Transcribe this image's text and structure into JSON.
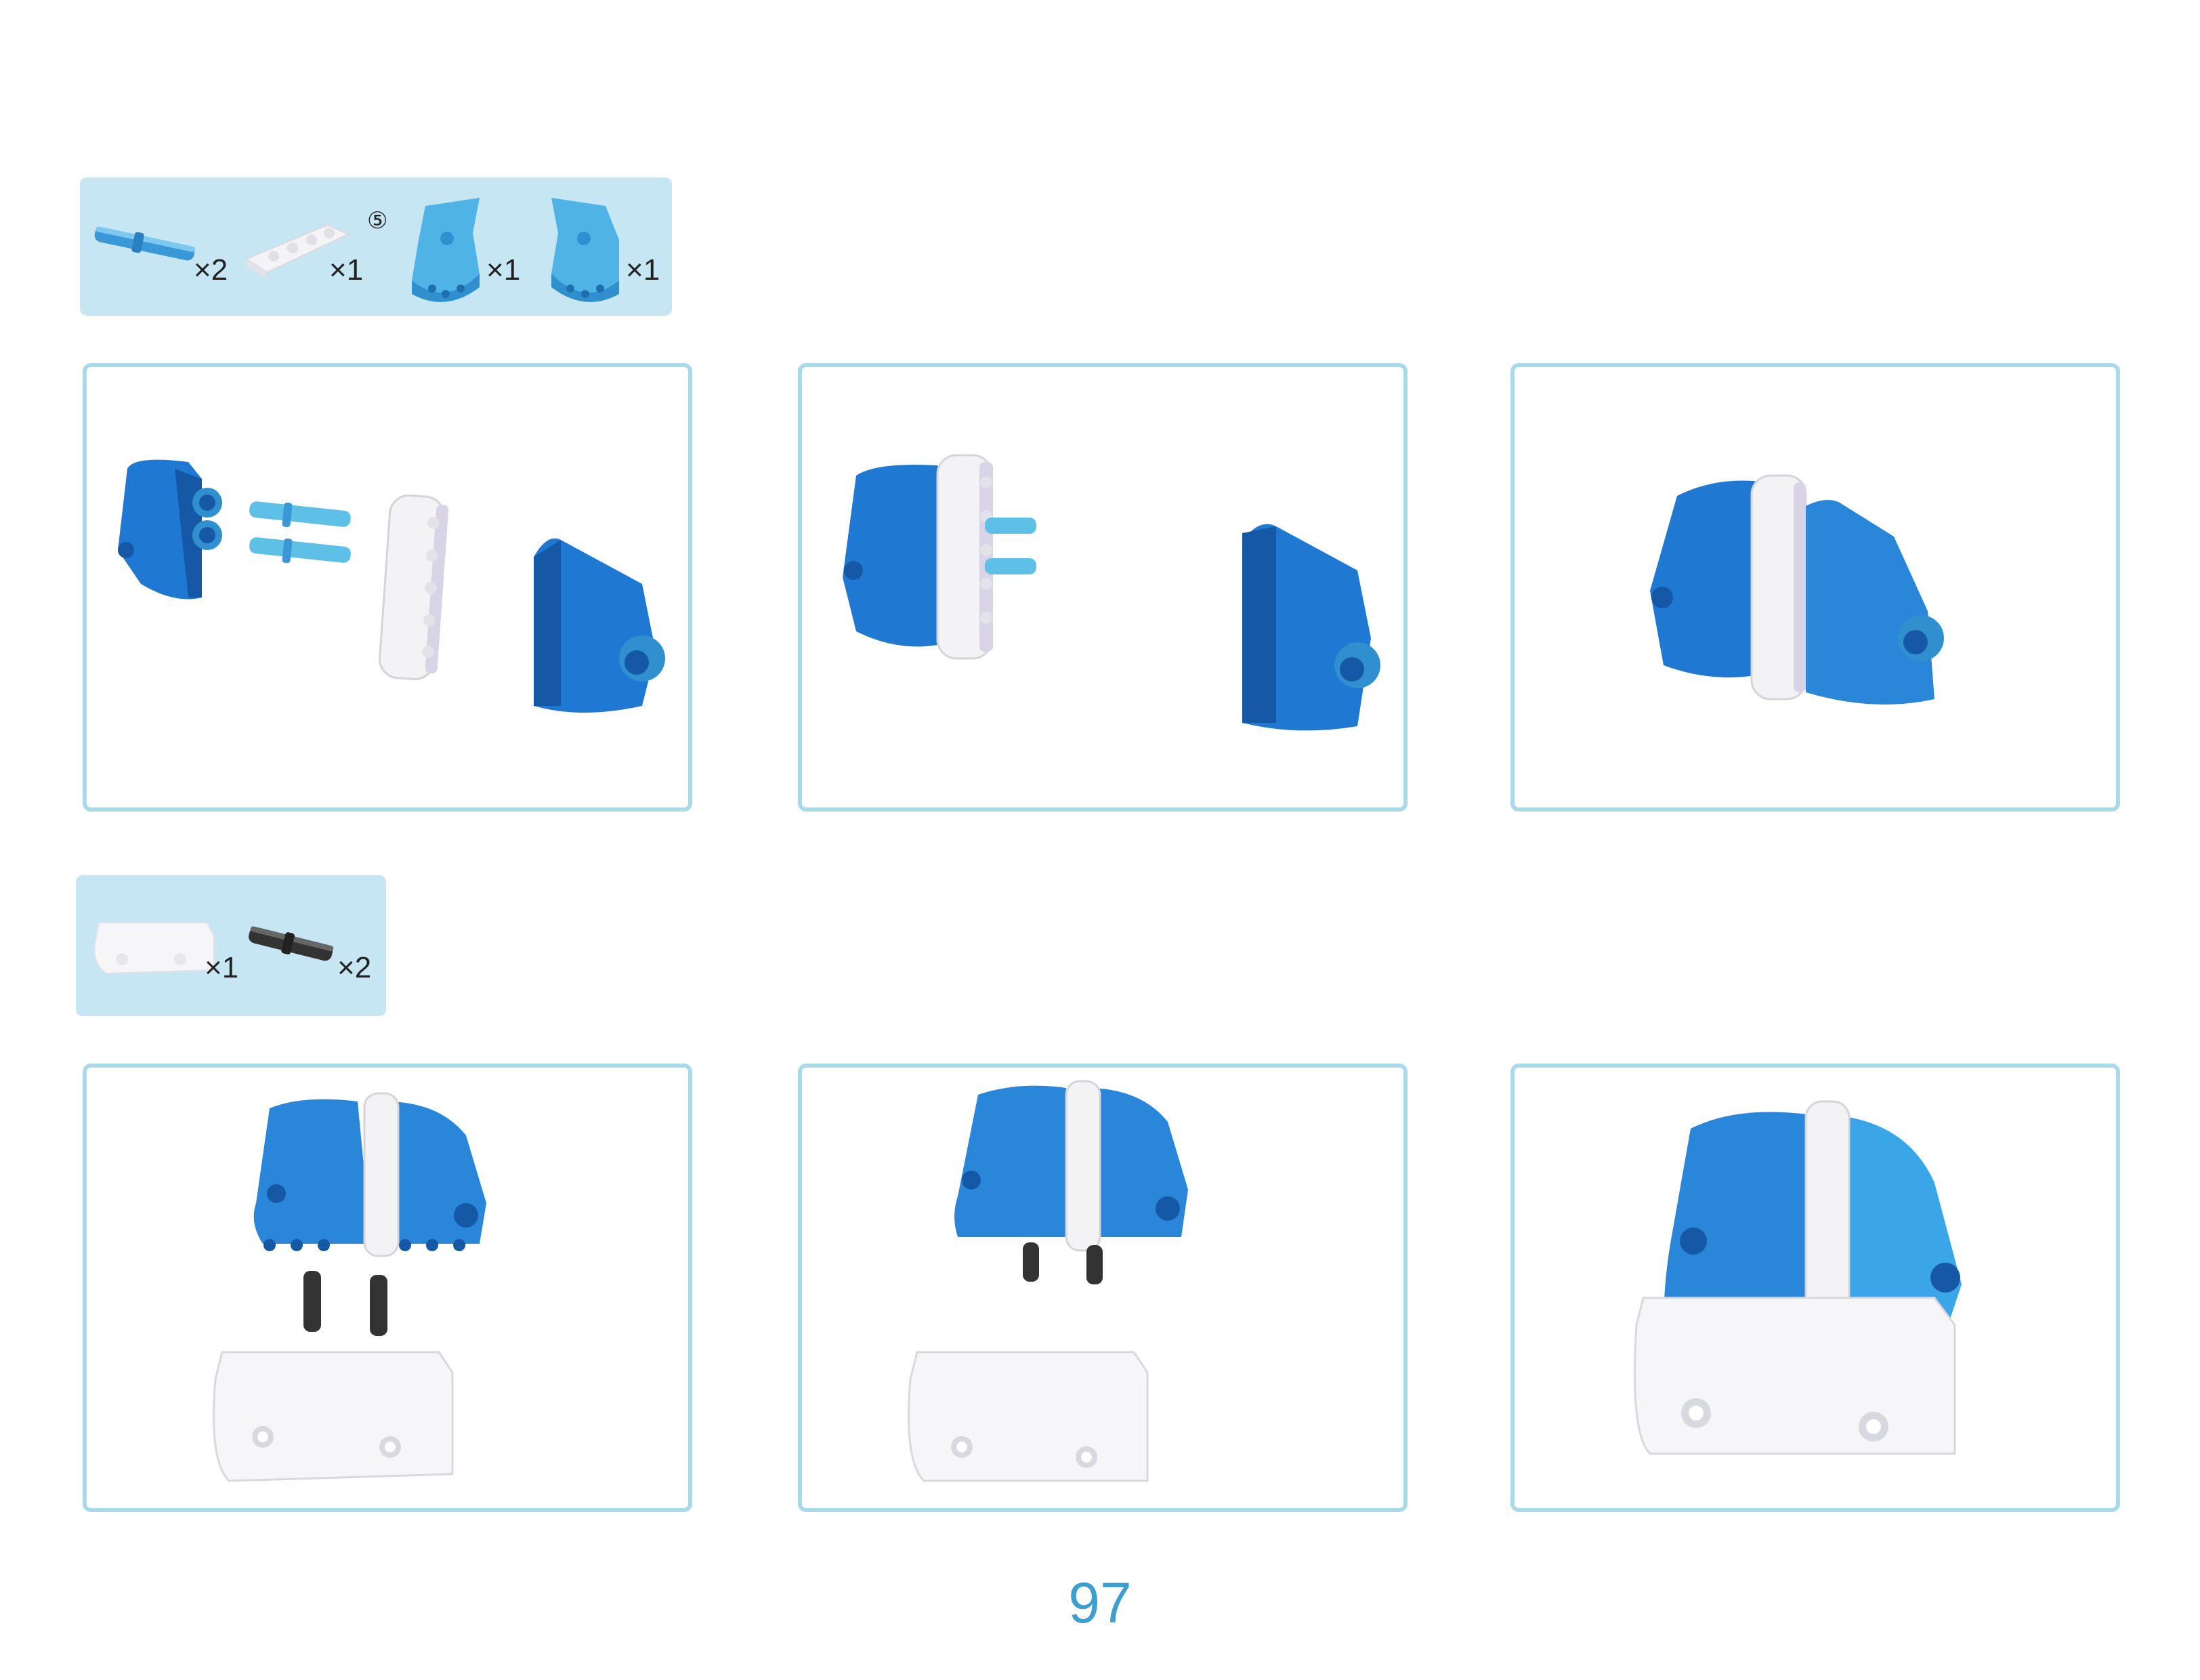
{
  "step_group_1": {
    "parts": [
      {
        "name": "blue-connector-pin",
        "qty": "×2"
      },
      {
        "name": "white-beam",
        "qty": "×1",
        "length_badge": "⑤"
      },
      {
        "name": "blue-panel-left",
        "qty": "×1"
      },
      {
        "name": "blue-panel-right",
        "qty": "×1"
      }
    ]
  },
  "step_group_2": {
    "parts": [
      {
        "name": "white-block",
        "qty": "×1"
      },
      {
        "name": "black-connector-pin",
        "qty": "×2"
      }
    ]
  },
  "page_number": "97",
  "colors": {
    "parts_bg": "#c6e6f4",
    "panel_border": "#a9d9ea",
    "part_blue": "#1f78d1",
    "part_light_blue": "#5ec0e6",
    "page_number": "#3d9ed0"
  }
}
